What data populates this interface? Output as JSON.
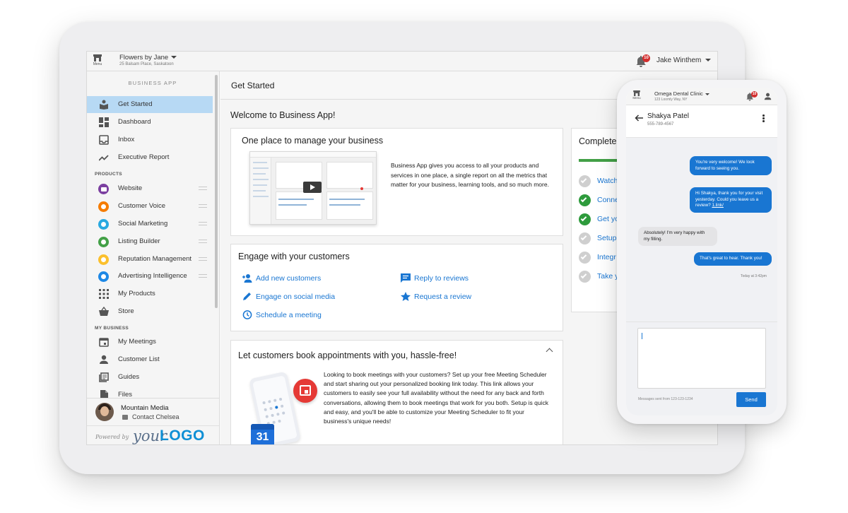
{
  "topbar": {
    "menu_label": "Menu",
    "business_name": "Flowers by Jane",
    "business_address": "25 Balsam Place, Saskatoon",
    "notification_count": "10",
    "user_name": "Jake Winthem"
  },
  "sidebar": {
    "title": "BUSINESS APP",
    "nav": [
      {
        "label": "Get Started",
        "icon": "book-icon",
        "active": true
      },
      {
        "label": "Dashboard",
        "icon": "dashboard-icon"
      },
      {
        "label": "Inbox",
        "icon": "inbox-icon"
      },
      {
        "label": "Executive Report",
        "icon": "trending-icon"
      }
    ],
    "products_heading": "PRODUCTS",
    "products": [
      {
        "label": "Website",
        "color": "#7b3fa0"
      },
      {
        "label": "Customer Voice",
        "color": "#f57c00"
      },
      {
        "label": "Social Marketing",
        "color": "#29a9e0"
      },
      {
        "label": "Listing Builder",
        "color": "#43a047"
      },
      {
        "label": "Reputation Management",
        "color": "#fbc02d"
      },
      {
        "label": "Advertising Intelligence",
        "color": "#1e88e5"
      },
      {
        "label": "My Products",
        "icon": "apps-icon"
      },
      {
        "label": "Store",
        "icon": "basket-icon"
      }
    ],
    "mybusiness_heading": "MY BUSINESS",
    "mybusiness": [
      {
        "label": "My Meetings",
        "icon": "calendar-icon"
      },
      {
        "label": "Customer List",
        "icon": "person-icon"
      },
      {
        "label": "Guides",
        "icon": "guides-icon"
      },
      {
        "label": "Files",
        "icon": "file-icon"
      }
    ],
    "footer": {
      "company": "Mountain Media",
      "contact": "Contact Chelsea",
      "powered_by": "Powered by",
      "logo_your": "your",
      "logo_logo": "LOGO"
    }
  },
  "main": {
    "page_title": "Get Started",
    "welcome": "Welcome to Business App!",
    "card_manage": {
      "title": "One place to manage your business",
      "description": "Business App gives you access to all your products and services in one place, a single report on all the metrics that matter for your business, learning tools, and so much more."
    },
    "card_engage": {
      "title": "Engage with your customers",
      "actions": [
        {
          "label": "Add new customers",
          "icon": "add-person-icon"
        },
        {
          "label": "Reply to reviews",
          "icon": "comment-icon"
        },
        {
          "label": "Engage on social media",
          "icon": "pencil-icon"
        },
        {
          "label": "Request a review",
          "icon": "star-icon"
        },
        {
          "label": "Schedule a meeting",
          "icon": "clock-icon"
        }
      ]
    },
    "card_book": {
      "title": "Let customers book appointments with you, hassle-free!",
      "description": "Looking to book meetings with your customers? Set up your free Meeting Scheduler and start sharing out your personalized booking link today. This link allows your customers to easily see your full availability without the need for any back and forth conversations, allowing them to book meetings that work for you both. Setup is quick and easy, and you'll be able to customize your Meeting Scheduler to fit your business's unique needs!",
      "calendar_day": "31"
    },
    "card_complete": {
      "title": "Complete",
      "progress": 0.45,
      "tasks": [
        {
          "label": "Watch",
          "done": false
        },
        {
          "label": "Conne",
          "done": true
        },
        {
          "label": "Get yo",
          "done": true
        },
        {
          "label": "Setup",
          "done": false
        },
        {
          "label": "Integr",
          "done": false
        },
        {
          "label": "Take y",
          "done": false
        }
      ]
    }
  },
  "phone": {
    "menu_label": "Menu",
    "business_name": "Omega Dental Clinic",
    "business_address": "123 Loomly Way, NY",
    "notification_count": "10",
    "contact_name": "Shakya Patel",
    "contact_phone": "555-789-4567",
    "messages": [
      {
        "dir": "out",
        "text": "You're very welcome! We look forward to seeing you."
      },
      {
        "dir": "out",
        "text": "Hi Shakya, thank you for your visit yesterday. Could you leave us a review?",
        "link": "1.link/"
      },
      {
        "dir": "in",
        "text": "Absolutely! I'm very happy with my filling."
      },
      {
        "dir": "out",
        "text": "That's great to hear. Thank you!"
      }
    ],
    "timestamp": "Today at 3:42pm",
    "sent_from": "Messages sent from 123-123-1234",
    "send_label": "Send",
    "input_value": ""
  }
}
